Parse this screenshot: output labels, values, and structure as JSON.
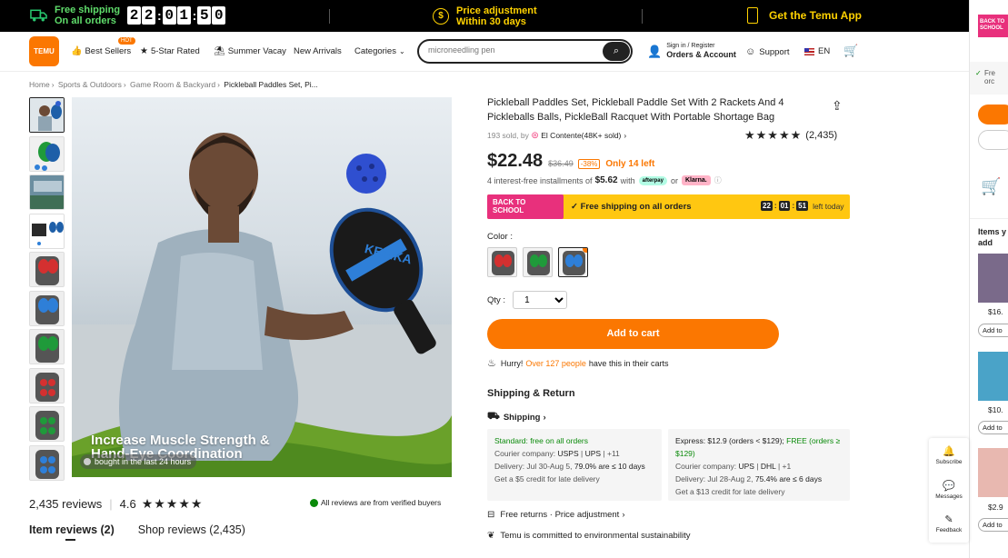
{
  "topbar": {
    "free_ship_1": "Free shipping",
    "free_ship_2": "On all orders",
    "timer": [
      "2",
      "2",
      "0",
      "1",
      "5",
      "0"
    ],
    "price_adj_1": "Price adjustment",
    "price_adj_2": "Within 30 days",
    "app": "Get the Temu App"
  },
  "nav": {
    "logo": "TEMU",
    "best_sellers": "Best Sellers",
    "hot": "HOT",
    "five_star": "5-Star Rated",
    "summer": "Summer Vacay",
    "new_arrivals": "New Arrivals",
    "categories": "Categories",
    "search_value": "microneedling pen",
    "signin_1": "Sign in / Register",
    "signin_2": "Orders & Account",
    "support": "Support",
    "lang": "EN"
  },
  "breadcrumb": [
    "Home",
    "Sports & Outdoors",
    "Game Room & Backyard",
    "Pickleball Paddles Set, Pi..."
  ],
  "gallery": {
    "banner_1": "Increase Muscle Strength &",
    "banner_2": "Hand-Eye Coordination",
    "bought": "bought in the last 24 hours",
    "paddle_brand": "KESIKA"
  },
  "reviews": {
    "count": "2,435 reviews",
    "avg": "4.6",
    "stars": "★★★★★",
    "verified": "All reviews are from verified buyers",
    "tab_item": "Item reviews (2)",
    "tab_shop": "Shop reviews (2,435)"
  },
  "product": {
    "title": "Pickleball Paddles Set, Pickleball Paddle Set With 2 Rackets And 4 Pickleballs Balls, PickleBall Racquet With Portable Shortage Bag",
    "sold": "193 sold, by",
    "store": "El Contente(48K+ sold)",
    "rating_stars": "★★★★★",
    "rating_count": "(2,435)",
    "price": "$22.48",
    "old_price": "$36.49",
    "discount": "-38%",
    "stock": "Only 14 left",
    "install_pre": "4 interest-free installments of",
    "install_amt": "$5.62",
    "install_with": "with",
    "afterpay": "afterpay",
    "or": "or",
    "klarna": "Klarna.",
    "promo_badge_1": "BACK TO",
    "promo_badge_2": "SCHOOL",
    "promo_ship": "Free shipping on all orders",
    "promo_t": [
      "22",
      "01",
      "51"
    ],
    "promo_left": "left today",
    "color_label": "Color :",
    "qty_label": "Qty :",
    "qty_value": "1",
    "add_to_cart": "Add to cart",
    "hurry_1": "Hurry!",
    "hurry_2": "Over 127 people",
    "hurry_3": "have this in their carts"
  },
  "shipping": {
    "heading": "Shipping & Return",
    "link": "Shipping",
    "std_title": "Standard: free on all orders",
    "std_courier": "Courier company:",
    "std_c1": "USPS",
    "std_c2": "UPS",
    "std_more": "+11",
    "std_delivery": "Delivery: Jul 30-Aug 5,",
    "std_pct": "79.0% are ≤ 10 days",
    "std_credit": "Get a $5 credit for late delivery",
    "exp_title": "Express: $12.9 (orders < $129);",
    "exp_free": "FREE (orders ≥ $129)",
    "exp_courier": "Courier company:",
    "exp_c1": "UPS",
    "exp_c2": "DHL",
    "exp_more": "+1",
    "exp_delivery": "Delivery: Jul 28-Aug 2,",
    "exp_pct": "75.4% are ≤ 6 days",
    "exp_credit": "Get a $13 credit for late delivery",
    "returns": "Free returns · Price adjustment",
    "env": "Temu is committed to environmental sustainability"
  },
  "sidepanel": {
    "subscribe": "Subscribe",
    "messages": "Messages",
    "feedback": "Feedback"
  },
  "cartpanel": {
    "badge": "BACK TO SCHOOL",
    "free": "Fre",
    "ord": "orc",
    "items": "Items y",
    "add": "add",
    "p1": "$16.",
    "p2": "$10.",
    "p3": "$2.9",
    "add_to": "Add to"
  },
  "colors": {
    "accent": "#fb7701",
    "green": "#0a8a0a",
    "promo": "#ffc711"
  }
}
